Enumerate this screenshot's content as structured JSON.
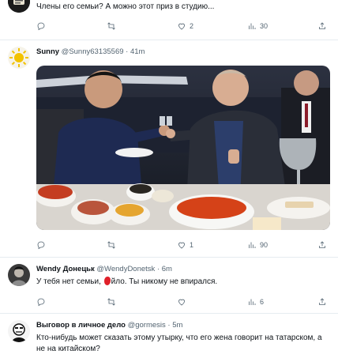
{
  "tweets": [
    {
      "text": "Члены его семьи? А можно этот приз в студию...",
      "reply_count": "",
      "retweet_count": "",
      "like_count": "2",
      "views": "30"
    },
    {
      "display_name": "Sunny",
      "handle": "@Sunny63135569",
      "sep": "·",
      "time": "41m",
      "reply_count": "",
      "retweet_count": "",
      "like_count": "1",
      "views": "90"
    },
    {
      "display_name": "Wendy Донецьк",
      "handle": "@WendyDonetsk",
      "sep": "·",
      "time": "6m",
      "text_before": "У тебя нет семьи, ",
      "text_after": "йло. Ты никому не впирался.",
      "reply_count": "",
      "retweet_count": "",
      "like_count": "",
      "views": "6"
    },
    {
      "display_name": "Выговор в личное дело",
      "handle": "@gormesis",
      "sep": "·",
      "time": "5m",
      "text": "Кто-нибудь может сказать этому утырку, что его жена говорит на татарском, а не на китайском?"
    }
  ],
  "colors": {
    "text": "#0f1419",
    "muted": "#536471",
    "divider": "#e6ecf0",
    "censor": "#e0202a"
  },
  "icons": [
    "reply-icon",
    "retweet-icon",
    "like-icon",
    "views-icon",
    "share-icon"
  ]
}
